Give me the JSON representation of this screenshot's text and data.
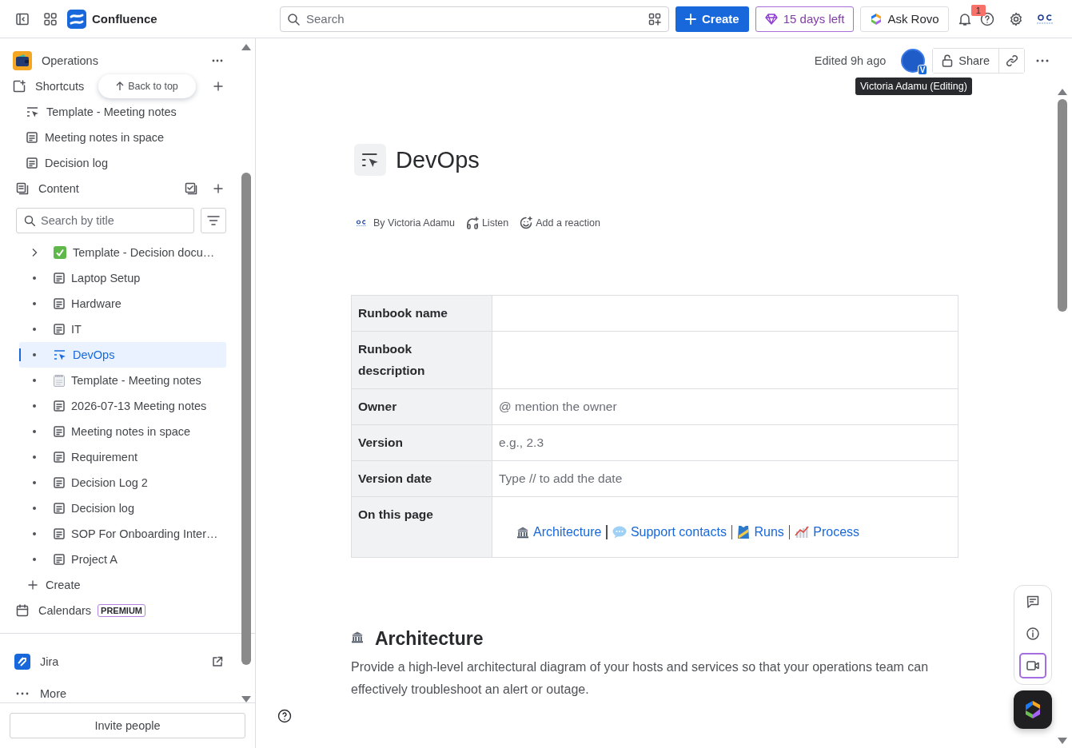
{
  "topbar": {
    "product": "Confluence",
    "search": {
      "placeholder": "Search"
    },
    "create": "Create",
    "trial": "15 days left",
    "ask": "Ask Rovo",
    "notifications": "1"
  },
  "sidebar": {
    "space": "Operations",
    "shortcuts": {
      "label": "Shortcuts",
      "items": [
        {
          "title": "Template - Meeting notes",
          "kind": "template"
        },
        {
          "title": "Meeting notes in space",
          "kind": "page"
        },
        {
          "title": "Decision log",
          "kind": "page"
        }
      ]
    },
    "back_to_top": "Back to top",
    "content": {
      "label": "Content",
      "search": {
        "placeholder": "Search by title"
      },
      "items": [
        {
          "title": "Template - Decision docu…",
          "kind": "check",
          "expandable": true,
          "selected": false
        },
        {
          "title": "Laptop Setup",
          "kind": "page",
          "expandable": false,
          "selected": false
        },
        {
          "title": "Hardware",
          "kind": "page",
          "expandable": false,
          "selected": false
        },
        {
          "title": "IT",
          "kind": "page",
          "expandable": false,
          "selected": false
        },
        {
          "title": "DevOps",
          "kind": "template",
          "expandable": false,
          "selected": true
        },
        {
          "title": "Template - Meeting notes",
          "kind": "notepad",
          "expandable": false,
          "selected": false
        },
        {
          "title": "2026-07-13 Meeting notes",
          "kind": "page",
          "expandable": false,
          "selected": false
        },
        {
          "title": "Meeting notes in space",
          "kind": "page",
          "expandable": false,
          "selected": false
        },
        {
          "title": "Requirement",
          "kind": "page",
          "expandable": false,
          "selected": false
        },
        {
          "title": "Decision Log 2",
          "kind": "page",
          "expandable": false,
          "selected": false
        },
        {
          "title": "Decision log",
          "kind": "page",
          "expandable": false,
          "selected": false
        },
        {
          "title": "SOP For Onboarding Inter…",
          "kind": "page",
          "expandable": false,
          "selected": false
        },
        {
          "title": "Project A",
          "kind": "page",
          "expandable": false,
          "selected": false
        }
      ],
      "create": "Create"
    },
    "calendars": {
      "label": "Calendars",
      "badge": "PREMIUM"
    },
    "apps": [
      {
        "label": "Jira"
      }
    ],
    "more": "More",
    "invite": "Invite people"
  },
  "page": {
    "edited": "Edited 9h ago",
    "avatar_badge": "V",
    "share": "Share",
    "tooltip": "Victoria Adamu (Editing)",
    "title": "DevOps",
    "byline": {
      "author": "By Victoria Adamu",
      "listen": "Listen",
      "reaction": "Add a reaction"
    },
    "table": {
      "rows": [
        {
          "label": "Runbook name",
          "kind": "empty"
        },
        {
          "label": "Runbook description",
          "kind": "empty"
        },
        {
          "label": "Owner",
          "kind": "placeholder",
          "value": "@ mention the owner"
        },
        {
          "label": "Version",
          "kind": "placeholder",
          "value": "e.g., 2.3"
        },
        {
          "label": "Version date",
          "kind": "placeholder",
          "value": "Type // to add the date"
        },
        {
          "label": "On this page",
          "kind": "links",
          "links": [
            {
              "text": "Architecture",
              "kind": "bank"
            },
            {
              "text": "Support contacts",
              "kind": "speech"
            },
            {
              "text": "Runs",
              "kind": "shirt"
            },
            {
              "text": "Process",
              "kind": "chart"
            }
          ]
        }
      ]
    },
    "section": {
      "heading": "Architecture",
      "text": "Provide a high-level architectural diagram of your hosts and services so that your operations team can effectively troubleshoot an alert or outage."
    }
  }
}
